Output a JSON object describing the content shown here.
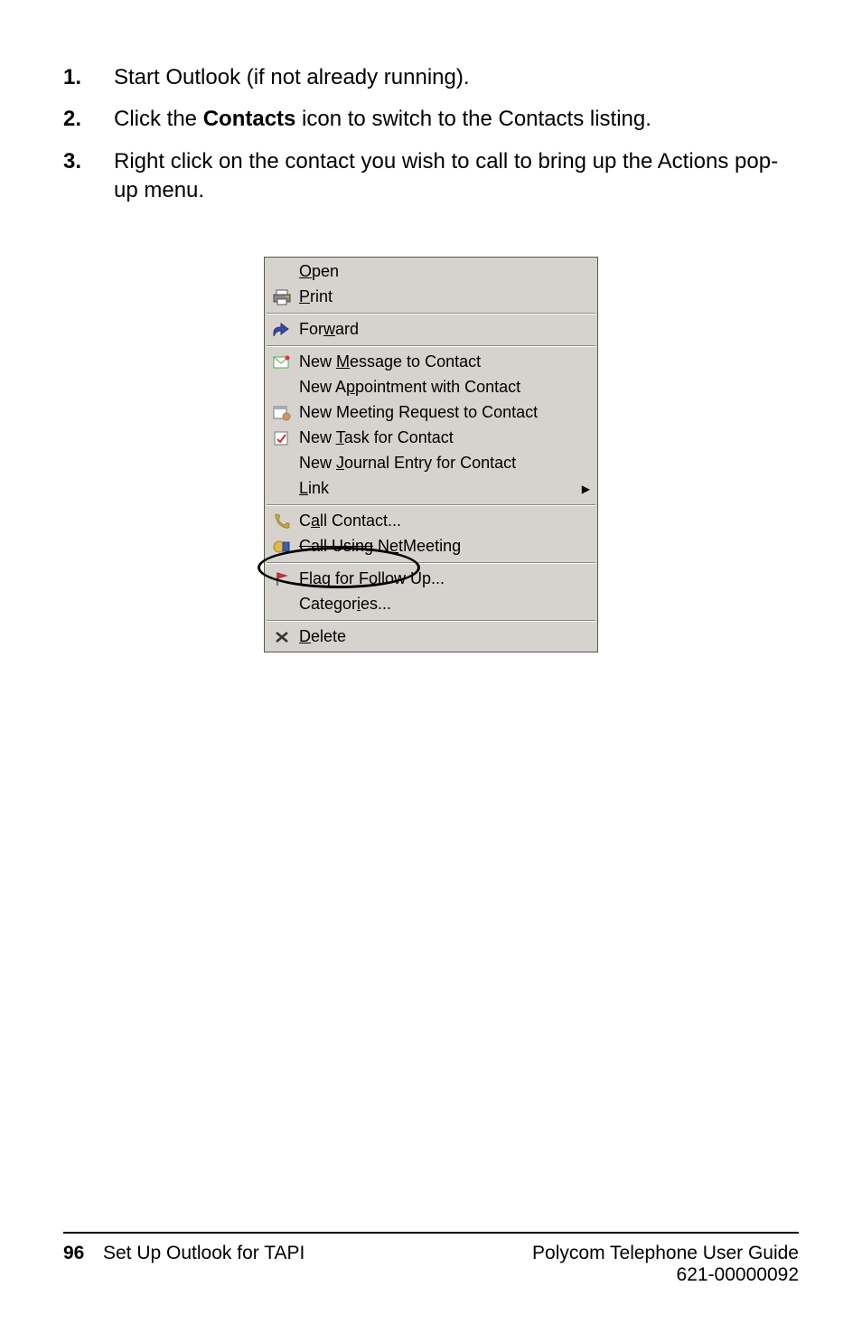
{
  "steps": [
    {
      "num": "1.",
      "text": "Start Outlook (if not already running)."
    },
    {
      "num": "2.",
      "prefix": "Click the ",
      "bold": "Contacts",
      "suffix": " icon to switch to the Contacts listing."
    },
    {
      "num": "3.",
      "text": "Right click on the contact you wish to call to bring up the Actions pop-up menu."
    }
  ],
  "menu": {
    "items": [
      {
        "label": "Open",
        "icon": "none"
      },
      {
        "label": "Print",
        "icon": "printer"
      }
    ],
    "group2": [
      {
        "label": "Forward",
        "icon": "forward"
      }
    ],
    "group3": [
      {
        "label": "New Message to Contact",
        "icon": "message"
      },
      {
        "label": "New Appointment with Contact",
        "icon": "none"
      },
      {
        "label": "New Meeting Request to Contact",
        "icon": "meeting"
      },
      {
        "label": "New Task for Contact",
        "icon": "task"
      },
      {
        "label": "New Journal Entry for Contact",
        "icon": "none"
      },
      {
        "label": "Link",
        "icon": "none",
        "submenu": true
      }
    ],
    "group4": [
      {
        "label": "Call Contact...",
        "icon": "phone",
        "circled": true
      },
      {
        "label": "Call Using NetMeeting",
        "icon": "netmeeting",
        "strike": true
      }
    ],
    "group5": [
      {
        "label": "Flag for Follow Up...",
        "icon": "flag"
      },
      {
        "label": "Categories...",
        "icon": "none"
      }
    ],
    "group6": [
      {
        "label": "Delete",
        "icon": "delete"
      }
    ]
  },
  "footer": {
    "page": "96",
    "left": "Set Up Outlook for TAPI",
    "rightTitle": "Polycom Telephone User Guide",
    "rightNum": "621-00000092"
  }
}
